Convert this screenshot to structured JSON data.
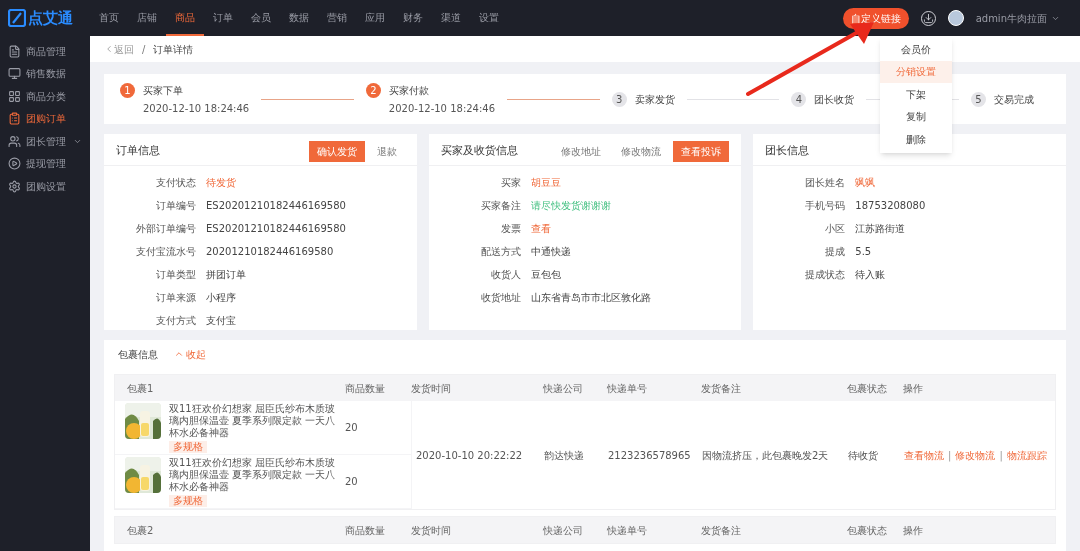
{
  "logo": "点艾通",
  "nav": [
    {
      "label": "首页",
      "selected": false
    },
    {
      "label": "店铺",
      "selected": false
    },
    {
      "label": "商品",
      "selected": true
    },
    {
      "label": "订单",
      "selected": false
    },
    {
      "label": "会员",
      "selected": false
    },
    {
      "label": "数据",
      "selected": false
    },
    {
      "label": "营销",
      "selected": false
    },
    {
      "label": "应用",
      "selected": false
    },
    {
      "label": "财务",
      "selected": false
    },
    {
      "label": "渠道",
      "selected": false
    },
    {
      "label": "设置",
      "selected": false
    }
  ],
  "header": {
    "custom_button": "自定义链接",
    "user": "admin牛肉拉面"
  },
  "dropdown": [
    {
      "label": "会员价",
      "selected": false
    },
    {
      "label": "分销设置",
      "selected": true
    },
    {
      "label": "下架",
      "selected": false
    },
    {
      "label": "复制",
      "selected": false
    },
    {
      "label": "删除",
      "selected": false
    }
  ],
  "sidebar": [
    {
      "label": "商品管理",
      "selected": false,
      "expandable": false
    },
    {
      "label": "销售数据",
      "selected": false,
      "expandable": false
    },
    {
      "label": "商品分类",
      "selected": false,
      "expandable": false
    },
    {
      "label": "团购订单",
      "selected": true,
      "expandable": false
    },
    {
      "label": "团长管理",
      "selected": false,
      "expandable": true
    },
    {
      "label": "提现管理",
      "selected": false,
      "expandable": false
    },
    {
      "label": "团购设置",
      "selected": false,
      "expandable": false
    }
  ],
  "breadcrumb": {
    "back": "返回",
    "separator": "/",
    "current": "订单详情"
  },
  "steps": [
    {
      "number": "1",
      "label": "买家下单",
      "time": "2020-12-10 18:24:46",
      "done": true
    },
    {
      "number": "2",
      "label": "买家付款",
      "time": "2020-12-10 18:24:46",
      "done": true
    },
    {
      "number": "3",
      "label": "卖家发货",
      "done": false
    },
    {
      "number": "4",
      "label": "团长收货",
      "done": false
    },
    {
      "number": "5",
      "label": "交易完成",
      "done": false
    }
  ],
  "cards": [
    {
      "title": "订单信息",
      "buttons": [
        {
          "label": "确认发货",
          "primary": true
        },
        {
          "label": "退款",
          "primary": false
        }
      ],
      "rows": [
        {
          "label": "支付状态",
          "value": "待发货",
          "kind": "status"
        },
        {
          "label": "订单编号",
          "value": "ES20201210182446169580",
          "kind": "text"
        },
        {
          "label": "外部订单编号",
          "value": "ES20201210182446169580",
          "kind": "text"
        },
        {
          "label": "支付宝流水号",
          "value": "20201210182446169580",
          "kind": "text"
        },
        {
          "label": "订单类型",
          "value": "拼团订单",
          "kind": "text"
        },
        {
          "label": "订单来源",
          "value": "小程序",
          "kind": "text"
        },
        {
          "label": "支付方式",
          "value": "支付宝",
          "kind": "text"
        }
      ]
    },
    {
      "title": "买家及收货信息",
      "buttons": [
        {
          "label": "修改地址",
          "primary": false
        },
        {
          "label": "修改物流",
          "primary": false
        },
        {
          "label": "查看投诉",
          "primary": true
        }
      ],
      "rows": [
        {
          "label": "买家",
          "value": "胡豆豆",
          "kind": "link"
        },
        {
          "label": "买家备注",
          "value": "请尽快发货谢谢谢",
          "kind": "note"
        },
        {
          "label": "发票",
          "value": "查看",
          "kind": "link"
        },
        {
          "label": "配送方式",
          "value": "中通快递",
          "kind": "text"
        },
        {
          "label": "收货人",
          "value": "豆包包",
          "kind": "text"
        },
        {
          "label": "收货地址",
          "value": "山东省青岛市市北区敦化路",
          "kind": "text"
        }
      ]
    },
    {
      "title": "团长信息",
      "rows": [
        {
          "label": "团长姓名",
          "value": "飒飒",
          "kind": "link"
        },
        {
          "label": "手机号码",
          "value": "18753208080",
          "kind": "text"
        },
        {
          "label": "小区",
          "value": "江苏路街道",
          "kind": "text"
        },
        {
          "label": "提成",
          "value": "5.5",
          "kind": "text"
        },
        {
          "label": "提成状态",
          "value": "待入账",
          "kind": "text"
        }
      ]
    }
  ],
  "packages": {
    "title": "包裹信息",
    "toggle": "收起",
    "expanded": true,
    "list": [
      {
        "name": "包裹1",
        "columns": [
          "商品数量",
          "发货时间",
          "快递公司",
          "快递单号",
          "发货备注",
          "包裹状态",
          "操作"
        ],
        "items": [
          {
            "title": "双11狂欢价幻想家 屈臣氏纱布木质玻璃内胆保温壶 夏季系列限定款 一天八杯水必备神器",
            "tag": "多规格",
            "quantity": "20"
          },
          {
            "title": "双11狂欢价幻想家 屈臣氏纱布木质玻璃内胆保温壶 夏季系列限定款 一天八杯水必备神器",
            "tag": "多规格",
            "quantity": "20"
          }
        ],
        "ship_time": "2020-10-10 20:22:22",
        "courier": "韵达快递",
        "tracking": "2123236578965",
        "note": "因物流挤压，此包裹晚发2天",
        "status": "待收货",
        "actions": [
          {
            "label": "查看物流",
            "separator": "|"
          },
          {
            "label": "修改物流",
            "separator": "|"
          },
          {
            "label": "物流跟踪"
          }
        ]
      },
      {
        "name": "包裹2",
        "columns": [
          "商品数量",
          "发货时间",
          "快递公司",
          "快递单号",
          "发货备注",
          "包裹状态",
          "操作"
        ]
      }
    ]
  }
}
